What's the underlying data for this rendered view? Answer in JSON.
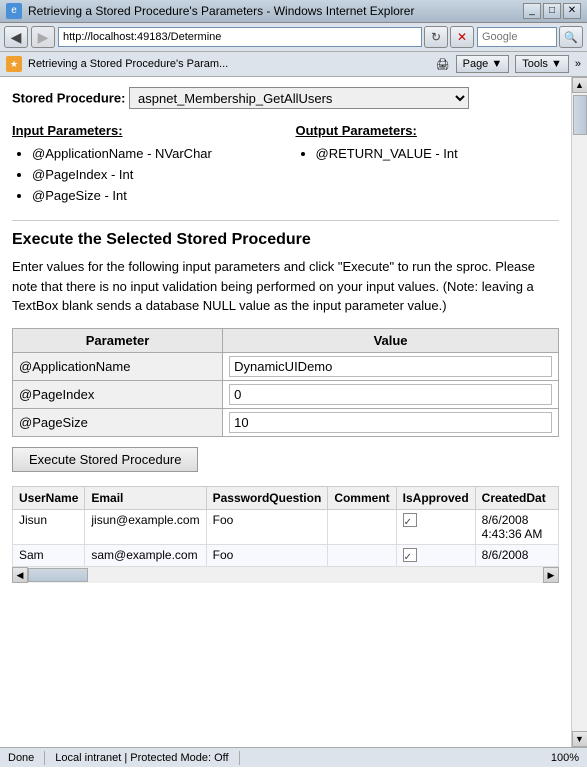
{
  "browser": {
    "title": "Retrieving a Stored Procedure's Parameters - Windows Internet Explorer",
    "icon": "e",
    "title_bar_buttons": [
      "_",
      "□",
      "✕"
    ],
    "nav": {
      "back_disabled": false,
      "forward_disabled": true,
      "refresh_label": "↻",
      "stop_label": "✕",
      "address": "http://localhost:49183/Determine",
      "search_placeholder": "Google",
      "go_label": "→"
    },
    "favorites_bar": {
      "fav_title": "Retrieving a Stored Procedure's Param...",
      "page_btn": "Page ▼",
      "tools_btn": "Tools ▼"
    }
  },
  "stored_procedure": {
    "label": "Stored Procedure:",
    "value": "aspnet_Membership_GetAllUsers",
    "options": [
      "aspnet_Membership_GetAllUsers"
    ]
  },
  "parameters": {
    "input_label": "Input Parameters:",
    "output_label": "Output Parameters:",
    "input_items": [
      "@ApplicationName - NVarChar",
      "@PageIndex - Int",
      "@PageSize - Int"
    ],
    "output_items": [
      "@RETURN_VALUE - Int"
    ]
  },
  "execute_section": {
    "heading": "Execute the Selected Stored Procedure",
    "description": "Enter values for the following input parameters and click \"Execute\" to run the sproc. Please note that there is no input validation being performed on your input values. (Note: leaving a TextBox blank sends a database NULL value as the input parameter value.)",
    "table": {
      "col_param": "Parameter",
      "col_value": "Value",
      "rows": [
        {
          "param": "@ApplicationName",
          "value": "DynamicUIDemo"
        },
        {
          "param": "@PageIndex",
          "value": "0"
        },
        {
          "param": "@PageSize",
          "value": "10"
        }
      ]
    },
    "execute_button": "Execute Stored Procedure"
  },
  "results": {
    "columns": [
      "UserName",
      "Email",
      "PasswordQuestion",
      "Comment",
      "IsApproved",
      "CreatedDat"
    ],
    "rows": [
      {
        "username": "Jisun",
        "email": "jisun@example.com",
        "password_question": "Foo",
        "comment": "",
        "is_approved": true,
        "created_date": "8/6/2008 4:43:36 AM"
      },
      {
        "username": "Sam",
        "email": "sam@example.com",
        "password_question": "Foo",
        "comment": "",
        "is_approved": true,
        "created_date": "8/6/2008"
      }
    ]
  },
  "status_bar": {
    "status": "Done",
    "zone": "Local intranet | Protected Mode: Off",
    "zoom": "100%"
  }
}
